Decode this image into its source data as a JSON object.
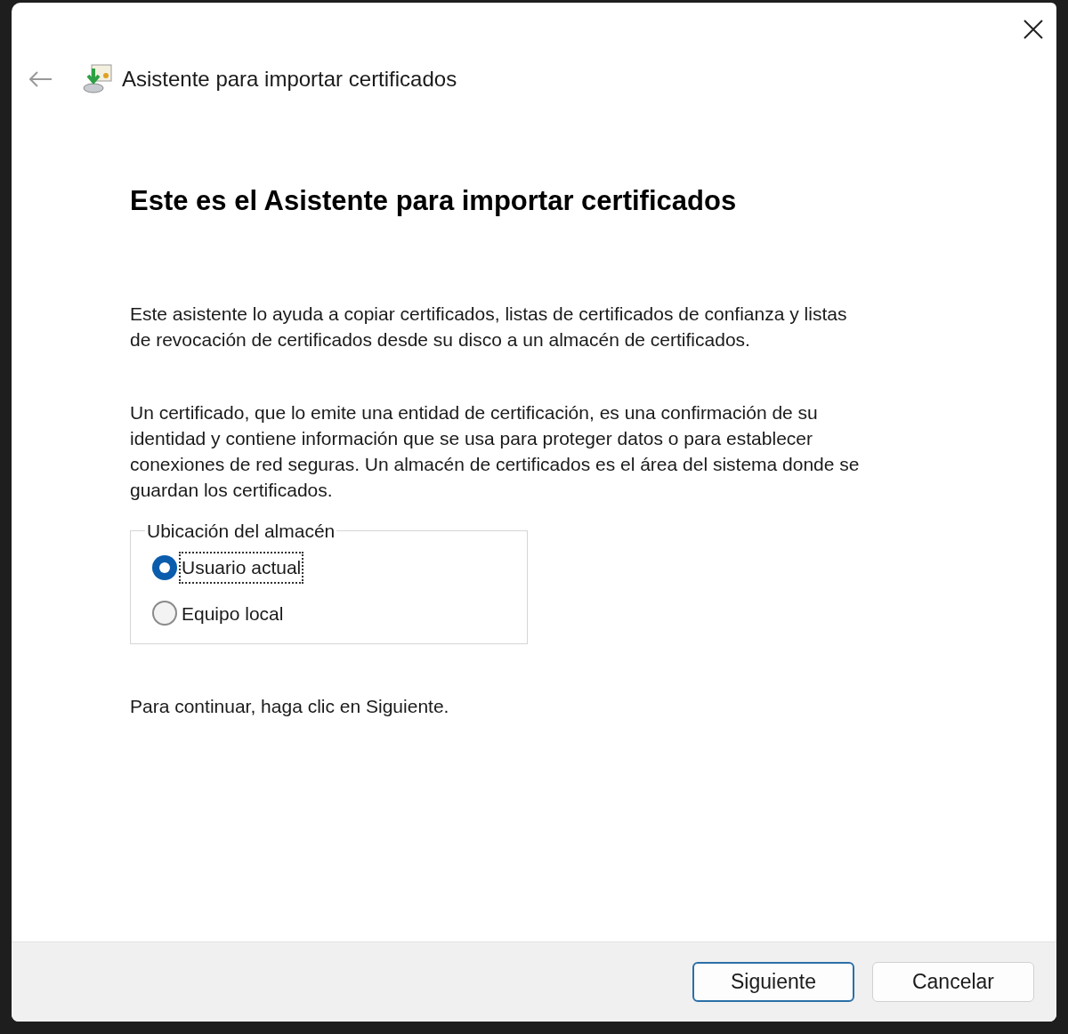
{
  "window": {
    "title": "Asistente para importar certificados"
  },
  "heading": "Este es el Asistente para importar certificados",
  "paragraphs": [
    "Este asistente lo ayuda a copiar certificados, listas de certificados de confianza y listas de revocación de certificados desde su disco a un almacén de certificados.",
    "Un certificado, que lo emite una entidad de certificación, es una confirmación de su identidad y contiene información que se usa para proteger datos o para establecer conexiones de red seguras. Un almacén de certificados es el área del sistema donde se guardan los certificados."
  ],
  "store_location": {
    "legend": "Ubicación del almacén",
    "options": [
      {
        "label": "Usuario actual",
        "selected": true
      },
      {
        "label": "Equipo local",
        "selected": false
      }
    ]
  },
  "instruction": "Para continuar, haga clic en Siguiente.",
  "buttons": [
    {
      "label": "Siguiente",
      "default": true
    },
    {
      "label": "Cancelar",
      "default": false
    }
  ]
}
